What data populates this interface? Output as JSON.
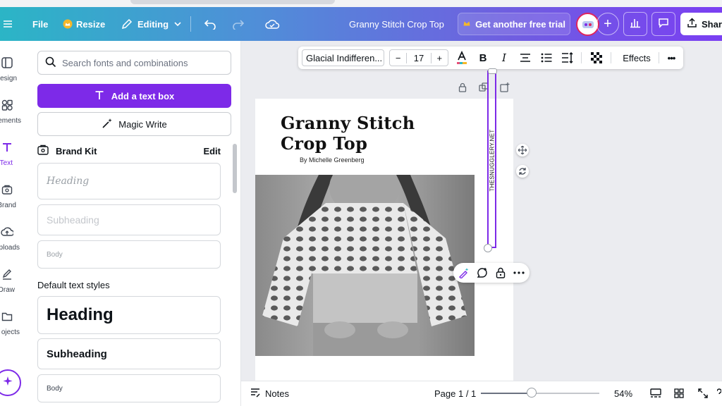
{
  "topbar": {
    "file_label": "File",
    "resize_label": "Resize",
    "editing_label": "Editing",
    "doc_title": "Granny Stitch Crop Top",
    "trial_label": "Get another free trial",
    "share_label": "Shar"
  },
  "rail": {
    "items": [
      {
        "label": "esign",
        "icon": "design-icon"
      },
      {
        "label": "ements",
        "icon": "elements-icon"
      },
      {
        "label": "Text",
        "icon": "text-icon"
      },
      {
        "label": "Brand",
        "icon": "brand-icon"
      },
      {
        "label": "ploads",
        "icon": "uploads-icon"
      },
      {
        "label": "Draw",
        "icon": "draw-icon"
      },
      {
        "label": "ojects",
        "icon": "projects-icon"
      }
    ],
    "active": "Text"
  },
  "panel": {
    "search_placeholder": "Search fonts and combinations",
    "add_text_label": "Add a text box",
    "magic_write_label": "Magic Write",
    "brand_kit_label": "Brand Kit",
    "brand_kit_edit": "Edit",
    "brand_styles": {
      "heading": "Heading",
      "subheading": "Subheading",
      "body": "Body"
    },
    "default_styles_title": "Default text styles",
    "default_styles": {
      "heading": "Heading",
      "subheading": "Subheading",
      "body": "Body"
    }
  },
  "toolbar": {
    "font_name": "Glacial Indifferen...",
    "font_size": "17",
    "minus": "−",
    "plus": "+",
    "bold": "B",
    "italic": "I",
    "effects_label": "Effects",
    "more": "•••"
  },
  "page": {
    "title_line1": "Granny Stitch",
    "title_line2": "Crop Top",
    "byline": "By Michelle Greenberg",
    "vertical_text": "THESNUGGLERY.NET"
  },
  "bottombar": {
    "notes_label": "Notes",
    "page_indicator": "Page 1 / 1",
    "zoom_label": "54%",
    "zoom_fraction": 0.43
  },
  "colors": {
    "accent": "#7d2ae8",
    "gradient_start": "#2bb5c6",
    "gradient_end": "#7a3ff2"
  }
}
